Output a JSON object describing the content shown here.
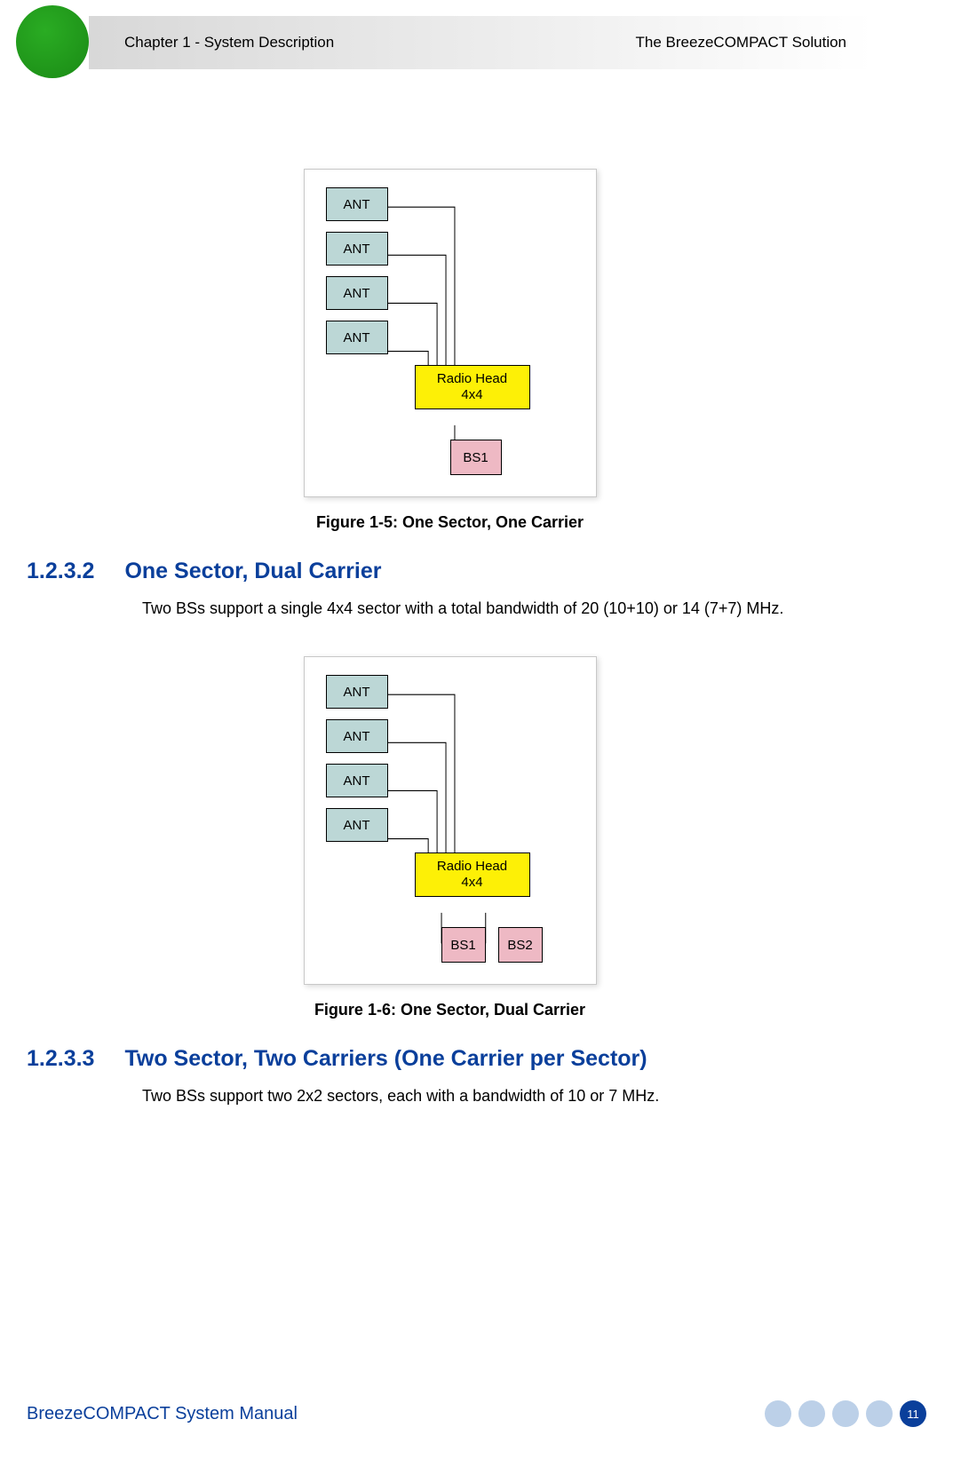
{
  "header": {
    "chapter": "Chapter 1 - System Description",
    "solution": "The BreezeCOMPACT Solution"
  },
  "figure1": {
    "ant": [
      "ANT",
      "ANT",
      "ANT",
      "ANT"
    ],
    "radio_l1": "Radio Head",
    "radio_l2": "4x4",
    "bs": [
      "BS1"
    ],
    "caption": "Figure 1-5: One Sector, One Carrier"
  },
  "section1": {
    "num": "1.2.3.2",
    "title": "One Sector, Dual Carrier",
    "body": "Two BSs support a single 4x4 sector with a total bandwidth of 20 (10+10) or 14 (7+7) MHz."
  },
  "figure2": {
    "ant": [
      "ANT",
      "ANT",
      "ANT",
      "ANT"
    ],
    "radio_l1": "Radio Head",
    "radio_l2": "4x4",
    "bs": [
      "BS1",
      "BS2"
    ],
    "caption": "Figure 1-6: One Sector, Dual Carrier"
  },
  "section2": {
    "num": "1.2.3.3",
    "title": "Two Sector, Two Carriers (One Carrier per Sector)",
    "body": "Two BSs support two 2x2 sectors, each with a bandwidth of 10 or 7 MHz."
  },
  "footer": {
    "manual": "BreezeCOMPACT System Manual",
    "page": "11"
  }
}
